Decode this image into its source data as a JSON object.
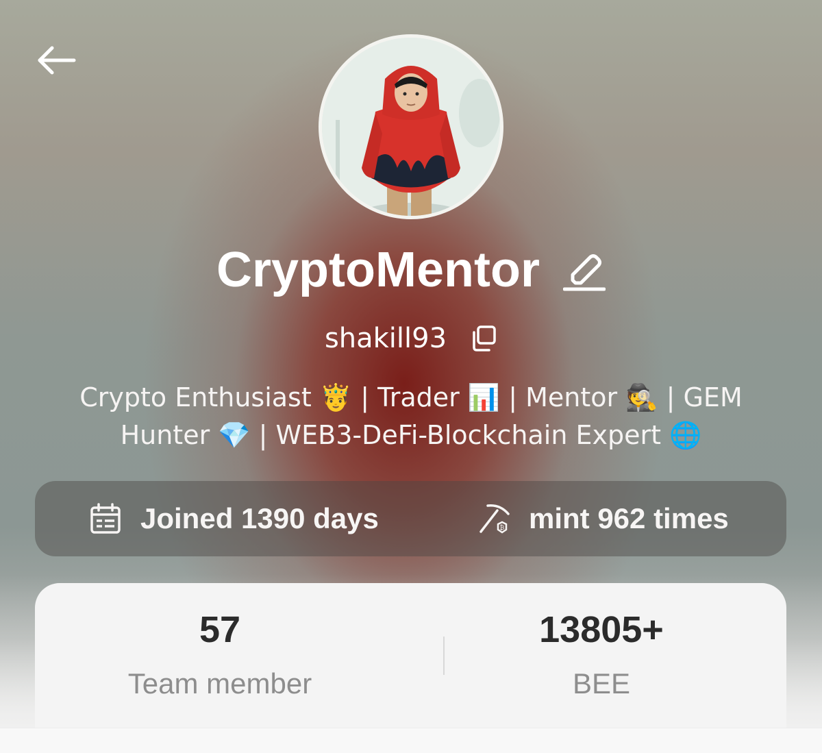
{
  "profile": {
    "display_name": "CryptoMentor",
    "handle": "shakill93",
    "bio": "Crypto Enthusiast 🤴 | Trader 📊 | Mentor 🕵️ | GEM Hunter 💎 | WEB3-DeFi-Blockchain Expert 🌐"
  },
  "stats_pill": {
    "joined_text": "Joined 1390 days",
    "mint_text": "mint 962 times"
  },
  "summary": {
    "team_count": "57",
    "team_label": "Team member",
    "bee_value": "13805+",
    "bee_label": "BEE"
  },
  "icons": {
    "back": "arrow-left-icon",
    "edit": "pencil-icon",
    "copy": "copy-icon",
    "calendar": "calendar-icon",
    "mint": "pickaxe-icon"
  },
  "colors": {
    "accent_red": "#8b1d15",
    "text_white": "#ffffff",
    "card_bg": "#f4f4f4",
    "muted": "#8d8d8d"
  }
}
